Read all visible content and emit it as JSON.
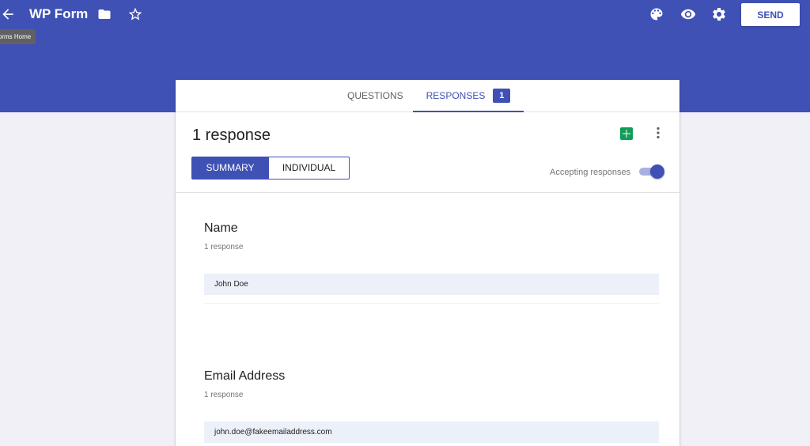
{
  "app": {
    "title": "WP Form",
    "tooltip": "Forms Home"
  },
  "toolbar": {
    "send_label": "SEND"
  },
  "tabs": [
    {
      "label": "QUESTIONS"
    },
    {
      "label": "RESPONSES",
      "badge": "1"
    }
  ],
  "summary": {
    "response_count": "1 response",
    "accepting_label": "Accepting responses",
    "accepting": true
  },
  "view_toggle": {
    "summary_label": "SUMMARY",
    "individual_label": "INDIVIDUAL"
  },
  "questions": [
    {
      "title": "Name",
      "count": "1 response",
      "answer": "John Doe"
    },
    {
      "title": "Email Address",
      "count": "1 response",
      "answer": "john.doe@fakeemailaddress.com"
    }
  ],
  "colors": {
    "brand": "#3f51b5",
    "sheets_green": "#0f9d58"
  },
  "icons": [
    "back-arrow-icon",
    "folder-icon",
    "star-icon",
    "palette-icon",
    "eye-icon",
    "gear-icon",
    "sheets-icon",
    "more-vert-icon"
  ]
}
